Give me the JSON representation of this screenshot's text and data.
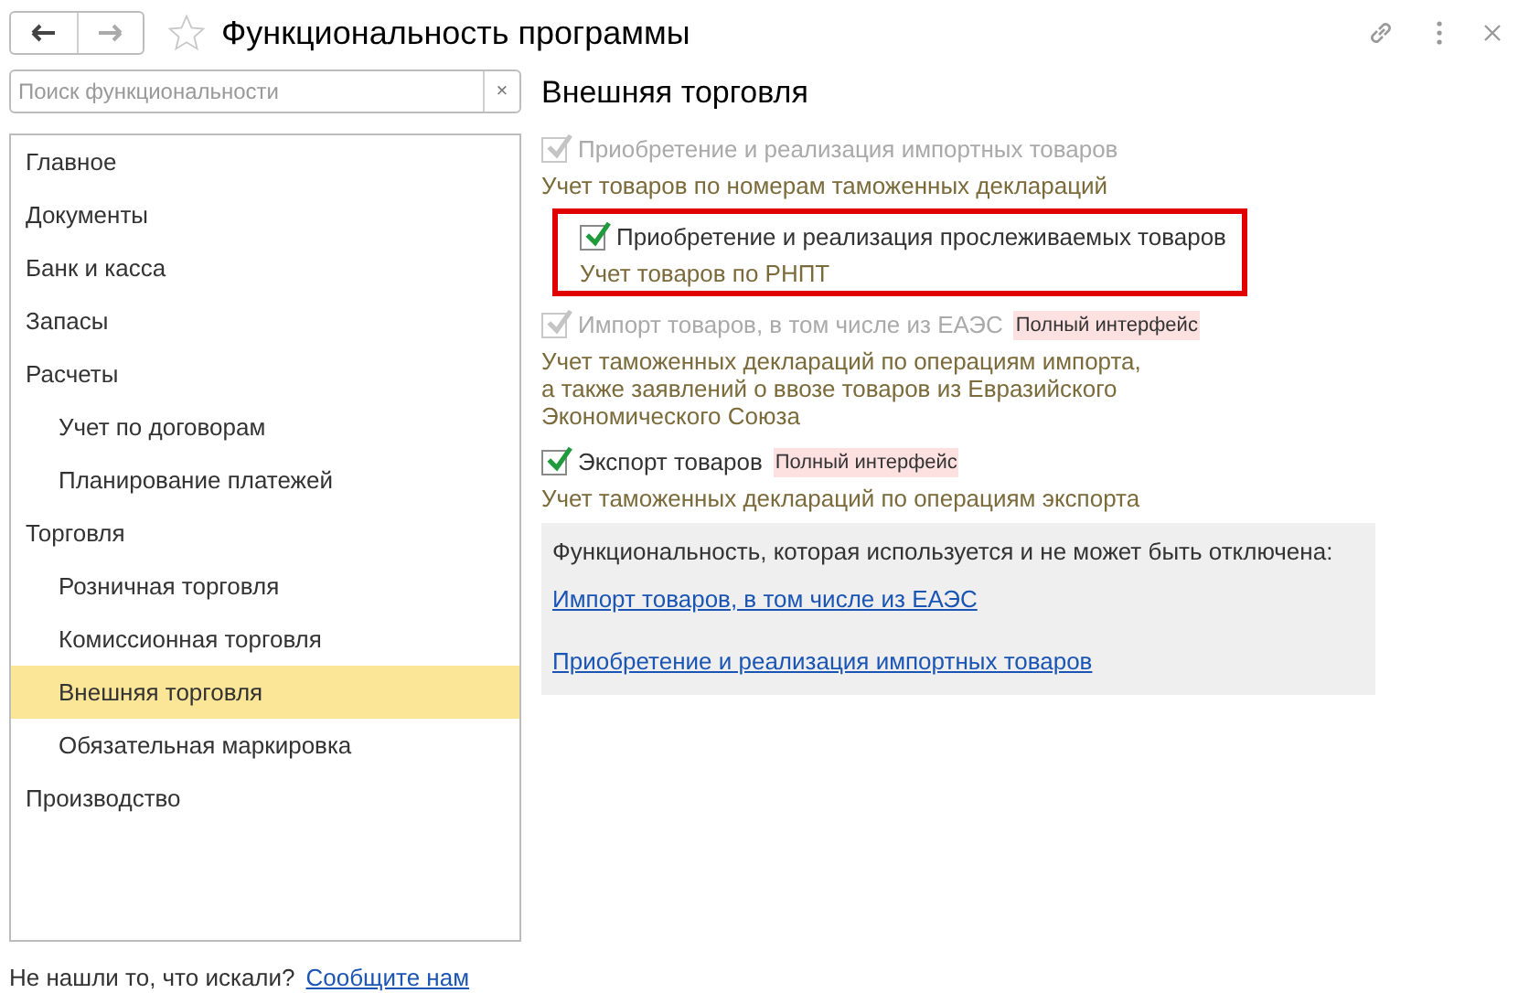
{
  "window": {
    "title": "Функциональность программы",
    "favorite": false
  },
  "search": {
    "placeholder": "Поиск функциональности",
    "clear": "×"
  },
  "sidebar": {
    "items": [
      {
        "label": "Главное",
        "selected": false
      },
      {
        "label": "Документы",
        "selected": false
      },
      {
        "label": "Банк и касса",
        "selected": false
      },
      {
        "label": "Запасы",
        "selected": false
      },
      {
        "label": "Расчеты",
        "selected": false,
        "children": [
          {
            "label": "Учет по договорам",
            "selected": false
          },
          {
            "label": "Планирование платежей",
            "selected": false
          }
        ]
      },
      {
        "label": "Торговля",
        "selected": false,
        "children": [
          {
            "label": "Розничная торговля",
            "selected": false
          },
          {
            "label": "Комиссионная торговля",
            "selected": false
          },
          {
            "label": "Внешняя торговля",
            "selected": true
          },
          {
            "label": "Обязательная маркировка",
            "selected": false
          }
        ]
      },
      {
        "label": "Производство",
        "selected": false
      }
    ]
  },
  "section": {
    "title": "Внешняя торговля",
    "options": [
      {
        "label": "Приобретение и реализация импортных товаров",
        "checked": true,
        "disabled": true,
        "highlighted": false,
        "description": [
          "Учет товаров по номерам таможенных деклараций"
        ]
      },
      {
        "label": "Приобретение и реализация прослеживаемых товаров",
        "checked": true,
        "disabled": false,
        "highlighted": true,
        "description": [
          "Учет товаров по РНПТ"
        ]
      },
      {
        "label": "Импорт товаров, в том числе из ЕАЭС",
        "checked": true,
        "disabled": true,
        "highlighted": false,
        "badge": "Полный интерфейс",
        "description": [
          "Учет таможенных деклараций по операциям импорта,",
          "а также заявлений о ввозе товаров из Евразийского",
          "Экономического Союза"
        ]
      },
      {
        "label": "Экспорт товаров",
        "checked": true,
        "disabled": false,
        "highlighted": false,
        "badge": "Полный интерфейс",
        "description": [
          "Учет таможенных деклараций по операциям экспорта"
        ]
      }
    ],
    "locked": {
      "text": "Функциональность, которая используется и не может быть отключена:",
      "links": [
        "Импорт товаров, в том числе из ЕАЭС",
        "Приобретение и реализация импортных товаров"
      ]
    }
  },
  "footer": {
    "text": "Не нашли то, что искали?",
    "link": "Сообщите нам"
  }
}
